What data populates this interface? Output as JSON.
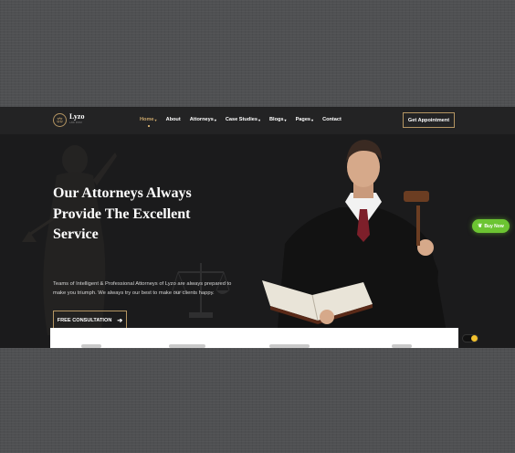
{
  "brand": {
    "name": "Lyzo",
    "tagline": "LAW FIRM"
  },
  "nav": {
    "items": [
      {
        "label": "Home",
        "has_dropdown": true,
        "active": true
      },
      {
        "label": "About",
        "has_dropdown": false,
        "active": false
      },
      {
        "label": "Attorneys",
        "has_dropdown": true,
        "active": false
      },
      {
        "label": "Case Studies",
        "has_dropdown": true,
        "active": false
      },
      {
        "label": "Blogs",
        "has_dropdown": true,
        "active": false
      },
      {
        "label": "Pages",
        "has_dropdown": true,
        "active": false
      },
      {
        "label": "Contact",
        "has_dropdown": false,
        "active": false
      }
    ],
    "cta_label": "Get Appointment"
  },
  "hero": {
    "title_lines": [
      "Our Attorneys Always",
      "Provide The Excellent",
      "Service"
    ],
    "description_lines": [
      "Teams of Intelligent & Professional Attorneys of Lyzo are always prepared to",
      "make you triumph. We always try our best to make our clients happy."
    ],
    "button_label": "FREE CONSULTATION",
    "button_icon": "arrow-right-icon"
  },
  "floating": {
    "buy_now_label": "Buy Now",
    "buy_now_icon": "leaf-icon"
  },
  "colors": {
    "accent": "#b49562",
    "active_nav": "#c8a56a",
    "hero_bg": "#1b1b1c",
    "buy_now": "#6cc432",
    "page_bg": "#4f5052"
  }
}
